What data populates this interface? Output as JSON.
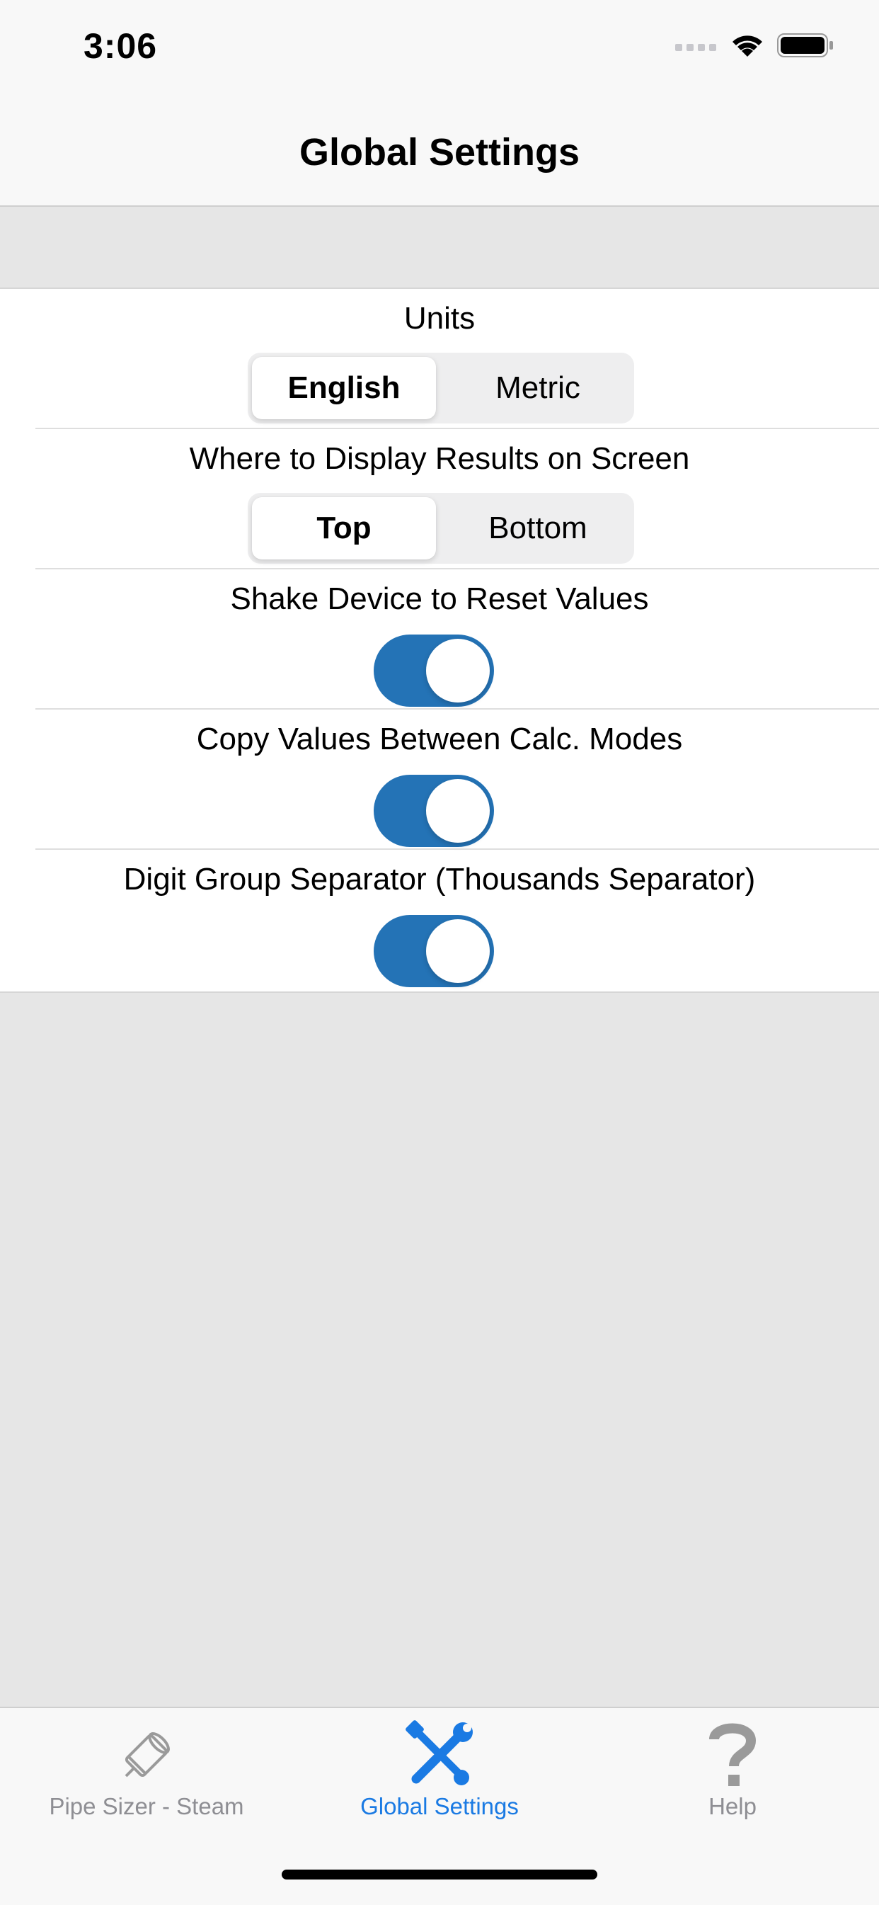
{
  "status_bar": {
    "time": "3:06"
  },
  "nav": {
    "title": "Global Settings"
  },
  "settings": {
    "units": {
      "label": "Units",
      "options": [
        "English",
        "Metric"
      ],
      "selected": "English"
    },
    "display_results": {
      "label": "Where to Display Results on Screen",
      "options": [
        "Top",
        "Bottom"
      ],
      "selected": "Top"
    },
    "shake_reset": {
      "label": "Shake Device to Reset Values",
      "on": true
    },
    "copy_values": {
      "label": "Copy Values Between Calc. Modes",
      "on": true
    },
    "digit_separator": {
      "label": "Digit Group Separator (Thousands Separator)",
      "on": true
    }
  },
  "tab_bar": {
    "tabs": [
      {
        "label": "Pipe Sizer - Steam",
        "icon": "pipe-icon",
        "active": false
      },
      {
        "label": "Global Settings",
        "icon": "wrench-screwdriver-icon",
        "active": true
      },
      {
        "label": "Help",
        "icon": "question-mark-icon",
        "active": false
      }
    ]
  },
  "colors": {
    "accent": "#2473b6",
    "tab_active": "#1a7ae3",
    "tab_inactive": "#8e8e93",
    "group_background": "#e6e6e6"
  }
}
